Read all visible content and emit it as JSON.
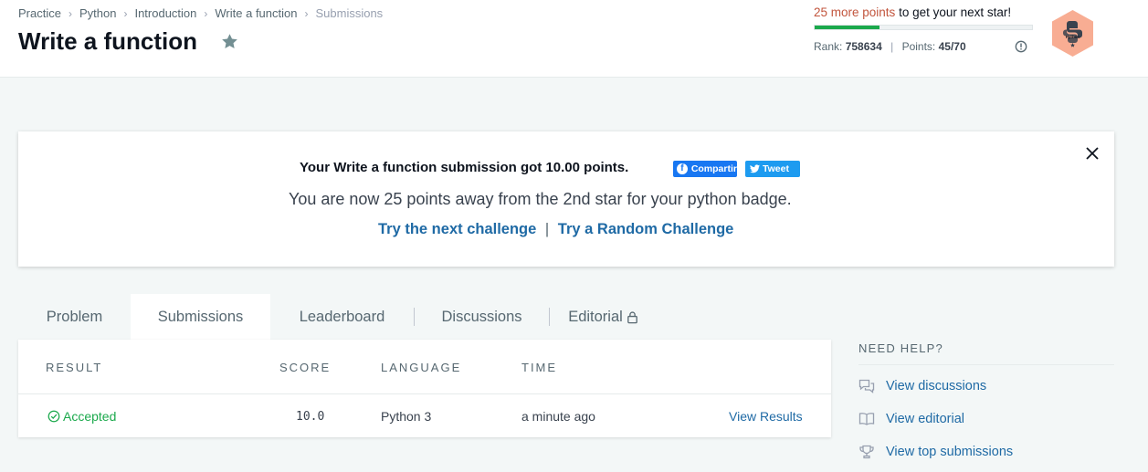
{
  "breadcrumb": {
    "items": [
      "Practice",
      "Python",
      "Introduction",
      "Write a function"
    ],
    "current": "Submissions"
  },
  "title": "Write a function",
  "progress": {
    "points_text": "25 more points",
    "rest_text": "to get your next star!",
    "fraction": 0.3,
    "rank_label": "Rank:",
    "rank_value": "758634",
    "points_label": "Points:",
    "points_value": "45/70"
  },
  "badge": {
    "label": "Python",
    "color": "#f8ad93"
  },
  "banner": {
    "line1": "Your Write a function submission got 10.00 points.",
    "share_label": "Compartir",
    "tweet_label": "Tweet",
    "line2": "You are now 25 points away from the 2nd star for your python badge.",
    "next_challenge": "Try the next challenge",
    "separator": "|",
    "random_challenge": "Try a Random Challenge"
  },
  "tabs": [
    {
      "label": "Problem",
      "active": false
    },
    {
      "label": "Submissions",
      "active": true
    },
    {
      "label": "Leaderboard",
      "active": false
    },
    {
      "label": "Discussions",
      "active": false
    },
    {
      "label": "Editorial",
      "active": false,
      "locked": true
    }
  ],
  "table": {
    "headers": [
      "RESULT",
      "SCORE",
      "LANGUAGE",
      "TIME"
    ],
    "rows": [
      {
        "result": "Accepted",
        "score": "10.0",
        "language": "Python 3",
        "time": "a minute ago",
        "action": "View Results"
      }
    ]
  },
  "help": {
    "title": "NEED HELP?",
    "items": [
      {
        "label": "View discussions",
        "icon": "discussion-icon"
      },
      {
        "label": "View editorial",
        "icon": "book-icon"
      },
      {
        "label": "View top submissions",
        "icon": "trophy-icon"
      }
    ]
  },
  "colors": {
    "accent_green": "#1ba94c",
    "link_blue": "#1f6aa5",
    "points_orange": "#c2553d"
  }
}
